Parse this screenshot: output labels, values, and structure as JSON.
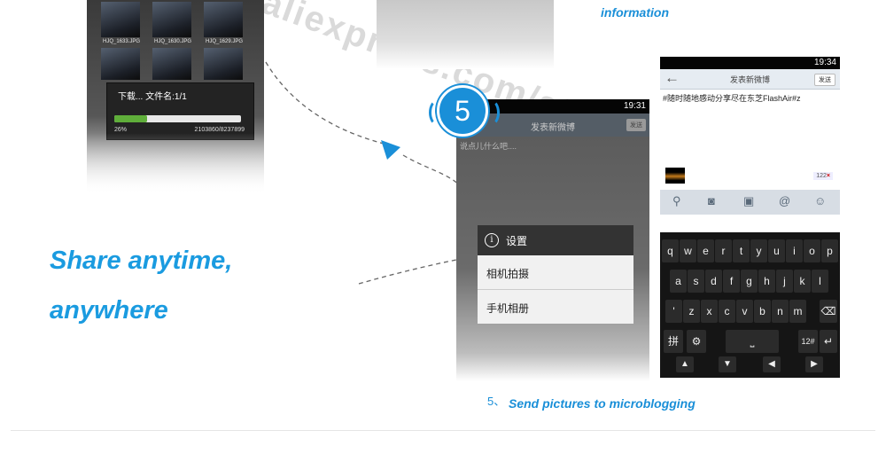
{
  "top_left_phone": {
    "thumbnails": [
      "HJQ_1633.JPG",
      "HJQ_1630.JPG",
      "HJQ_1629.JPG"
    ],
    "download_dialog": {
      "title": "下载... 文件名:1/1",
      "percent": "26%",
      "bytes": "2103860/8237899",
      "progress_fraction": 0.26
    }
  },
  "top_caption": "information",
  "watermark": "aliexpress.com/store/",
  "tagline": {
    "line1": "Share anytime,",
    "line2": "anywhere"
  },
  "step_badge": "5",
  "phone2": {
    "time": "19:31",
    "title": "发表新微博",
    "send": "发送",
    "hint": "说点儿什么吧....",
    "menu": {
      "title": "设置",
      "items": [
        "相机拍摄",
        "手机相册"
      ]
    }
  },
  "phone3": {
    "time": "19:34",
    "title": "发表新微博",
    "send": "发送",
    "text": "#随时随地感动分享尽在东芝FlashAir#z",
    "char_count": "122",
    "keyboard": {
      "row1": [
        "q",
        "w",
        "e",
        "r",
        "t",
        "y",
        "u",
        "i",
        "o",
        "p"
      ],
      "row2": [
        "a",
        "s",
        "d",
        "f",
        "g",
        "h",
        "j",
        "k",
        "l"
      ],
      "row3": [
        "'",
        "z",
        "x",
        "c",
        "v",
        "b",
        "n",
        "m"
      ],
      "row4_left": "拼",
      "row4_num": "12#"
    }
  },
  "caption": {
    "number": "5、",
    "text": "Send pictures to microblogging"
  },
  "colors": {
    "accent": "#1a8fd8",
    "progress": "#5fae3a"
  }
}
